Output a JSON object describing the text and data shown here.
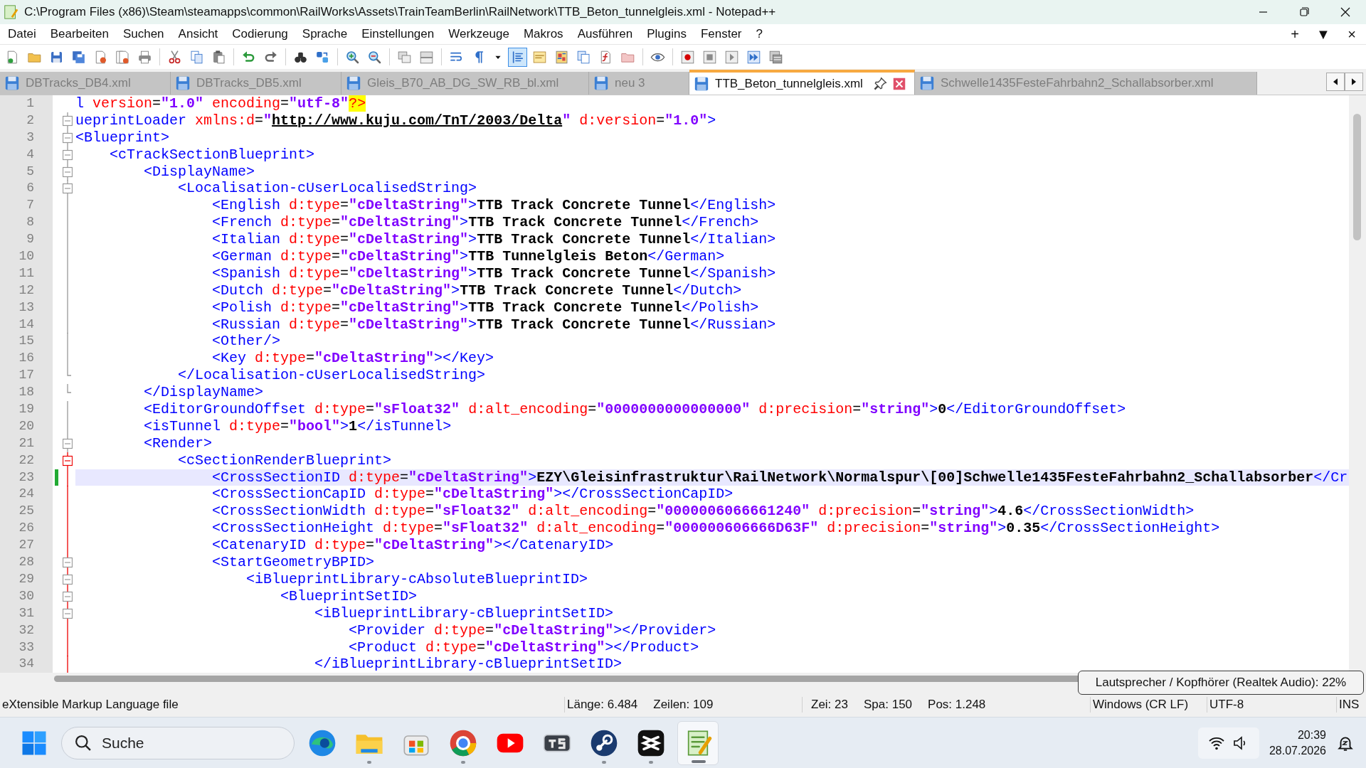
{
  "window": {
    "title": "C:\\Program Files (x86)\\Steam\\steamapps\\common\\RailWorks\\Assets\\TrainTeamBerlin\\RailNetwork\\TTB_Beton_tunnelgleis.xml - Notepad++"
  },
  "menu": [
    "Datei",
    "Bearbeiten",
    "Suchen",
    "Ansicht",
    "Codierung",
    "Sprache",
    "Einstellungen",
    "Werkzeuge",
    "Makros",
    "Ausführen",
    "Plugins",
    "Fenster",
    "?"
  ],
  "menu_right": [
    "+",
    "▼",
    "×"
  ],
  "toolbar": [
    [
      {
        "kind": "new",
        "on": false
      },
      {
        "kind": "open",
        "on": false
      },
      {
        "kind": "save",
        "on": false
      },
      {
        "kind": "saveall",
        "on": false
      },
      {
        "kind": "close",
        "on": false
      },
      {
        "kind": "closeall",
        "on": false
      },
      {
        "kind": "print",
        "on": false
      }
    ],
    [
      {
        "kind": "cut",
        "on": false
      },
      {
        "kind": "copy",
        "on": false
      },
      {
        "kind": "paste",
        "on": false
      }
    ],
    [
      {
        "kind": "undo",
        "on": false
      },
      {
        "kind": "redo",
        "on": false
      }
    ],
    [
      {
        "kind": "find",
        "on": false
      },
      {
        "kind": "replace",
        "on": false
      }
    ],
    [
      {
        "kind": "zoomin",
        "on": false
      },
      {
        "kind": "zoomout",
        "on": false
      }
    ],
    [
      {
        "kind": "syncv",
        "on": false
      },
      {
        "kind": "synch",
        "on": false
      }
    ],
    [
      {
        "kind": "wrap",
        "on": false
      },
      {
        "kind": "pilcrow",
        "on": false
      },
      {
        "kind": "caret",
        "on": false
      },
      {
        "kind": "indent",
        "on": true
      },
      {
        "kind": "udl",
        "on": false
      },
      {
        "kind": "map",
        "on": false
      },
      {
        "kind": "doclist",
        "on": false
      },
      {
        "kind": "func",
        "on": false
      },
      {
        "kind": "folder",
        "on": false
      }
    ],
    [
      {
        "kind": "eye",
        "on": false
      }
    ],
    [
      {
        "kind": "rec",
        "on": false
      },
      {
        "kind": "stop",
        "on": false
      },
      {
        "kind": "play",
        "on": false
      },
      {
        "kind": "playmulti",
        "on": false
      },
      {
        "kind": "macrosave",
        "on": false
      }
    ]
  ],
  "tabs": [
    {
      "label": "DBTracks_DB4.xml",
      "selected": false
    },
    {
      "label": "DBTracks_DB5.xml",
      "selected": false
    },
    {
      "label": "Gleis_B70_AB_DG_SW_RB_bl.xml",
      "selected": false
    },
    {
      "label": "neu 3",
      "selected": false
    },
    {
      "label": "TTB_Beton_tunnelgleis.xml",
      "selected": true
    },
    {
      "label": "Schwelle1435FesteFahrbahn2_Schallabsorber.xml",
      "selected": false
    }
  ],
  "lines": [
    {
      "number": "1",
      "fold": {
        "kind": "none"
      },
      "selected": false,
      "modified": false,
      "tokens": [
        {
          "kind": "tag",
          "text": "l"
        },
        {
          "kind": "attr",
          "text": " version"
        },
        {
          "kind": "eq",
          "text": "="
        },
        {
          "kind": "val",
          "text": "\"1.0\""
        },
        {
          "kind": "attr",
          "text": " encoding"
        },
        {
          "kind": "eq",
          "text": "="
        },
        {
          "kind": "val",
          "text": "\"utf-8\""
        },
        {
          "kind": "pi",
          "text": "?>"
        }
      ]
    },
    {
      "number": "2",
      "fold": {
        "kind": "box"
      },
      "selected": false,
      "modified": false,
      "tokens": [
        {
          "kind": "tag",
          "text": "ueprintLoader"
        },
        {
          "kind": "attr",
          "text": " xmlns:d"
        },
        {
          "kind": "eq",
          "text": "="
        },
        {
          "kind": "val",
          "text": "\""
        },
        {
          "kind": "link",
          "text": "http://www.kuju.com/TnT/2003/Delta"
        },
        {
          "kind": "val",
          "text": "\""
        },
        {
          "kind": "attr",
          "text": " d:version"
        },
        {
          "kind": "eq",
          "text": "="
        },
        {
          "kind": "val",
          "text": "\"1.0\""
        },
        {
          "kind": "tag",
          "text": ">"
        }
      ]
    },
    {
      "number": "3",
      "fold": {
        "kind": "box"
      },
      "selected": false,
      "modified": false,
      "tokens": [
        {
          "kind": "tag",
          "text": "<Blueprint>"
        }
      ]
    },
    {
      "number": "4",
      "fold": {
        "kind": "box"
      },
      "selected": false,
      "modified": false,
      "tokens": [
        {
          "kind": "tag",
          "text": "    <cTrackSectionBlueprint>"
        }
      ]
    },
    {
      "number": "5",
      "fold": {
        "kind": "box"
      },
      "selected": false,
      "modified": false,
      "tokens": [
        {
          "kind": "tag",
          "text": "        <DisplayName>"
        }
      ]
    },
    {
      "number": "6",
      "fold": {
        "kind": "box"
      },
      "selected": false,
      "modified": false,
      "tokens": [
        {
          "kind": "tag",
          "text": "            <Localisation-cUserLocalisedString>"
        }
      ]
    },
    {
      "number": "7",
      "fold": {
        "kind": "line"
      },
      "selected": false,
      "modified": false,
      "tokens": [
        {
          "kind": "tag",
          "text": "                <English"
        },
        {
          "kind": "attr",
          "text": " d:type"
        },
        {
          "kind": "eq",
          "text": "="
        },
        {
          "kind": "val",
          "text": "\"cDeltaString\""
        },
        {
          "kind": "tag",
          "text": ">"
        },
        {
          "kind": "text",
          "text": "TTB Track Concrete Tunnel"
        },
        {
          "kind": "tag",
          "text": "</English>"
        }
      ]
    },
    {
      "number": "8",
      "fold": {
        "kind": "line"
      },
      "selected": false,
      "modified": false,
      "tokens": [
        {
          "kind": "tag",
          "text": "                <French"
        },
        {
          "kind": "attr",
          "text": " d:type"
        },
        {
          "kind": "eq",
          "text": "="
        },
        {
          "kind": "val",
          "text": "\"cDeltaString\""
        },
        {
          "kind": "tag",
          "text": ">"
        },
        {
          "kind": "text",
          "text": "TTB Track Concrete Tunnel"
        },
        {
          "kind": "tag",
          "text": "</French>"
        }
      ]
    },
    {
      "number": "9",
      "fold": {
        "kind": "line"
      },
      "selected": false,
      "modified": false,
      "tokens": [
        {
          "kind": "tag",
          "text": "                <Italian"
        },
        {
          "kind": "attr",
          "text": " d:type"
        },
        {
          "kind": "eq",
          "text": "="
        },
        {
          "kind": "val",
          "text": "\"cDeltaString\""
        },
        {
          "kind": "tag",
          "text": ">"
        },
        {
          "kind": "text",
          "text": "TTB Track Concrete Tunnel"
        },
        {
          "kind": "tag",
          "text": "</Italian>"
        }
      ]
    },
    {
      "number": "10",
      "fold": {
        "kind": "line"
      },
      "selected": false,
      "modified": false,
      "tokens": [
        {
          "kind": "tag",
          "text": "                <German"
        },
        {
          "kind": "attr",
          "text": " d:type"
        },
        {
          "kind": "eq",
          "text": "="
        },
        {
          "kind": "val",
          "text": "\"cDeltaString\""
        },
        {
          "kind": "tag",
          "text": ">"
        },
        {
          "kind": "text",
          "text": "TTB Tunnelgleis Beton"
        },
        {
          "kind": "tag",
          "text": "</German>"
        }
      ]
    },
    {
      "number": "11",
      "fold": {
        "kind": "line"
      },
      "selected": false,
      "modified": false,
      "tokens": [
        {
          "kind": "tag",
          "text": "                <Spanish"
        },
        {
          "kind": "attr",
          "text": " d:type"
        },
        {
          "kind": "eq",
          "text": "="
        },
        {
          "kind": "val",
          "text": "\"cDeltaString\""
        },
        {
          "kind": "tag",
          "text": ">"
        },
        {
          "kind": "text",
          "text": "TTB Track Concrete Tunnel"
        },
        {
          "kind": "tag",
          "text": "</Spanish>"
        }
      ]
    },
    {
      "number": "12",
      "fold": {
        "kind": "line"
      },
      "selected": false,
      "modified": false,
      "tokens": [
        {
          "kind": "tag",
          "text": "                <Dutch"
        },
        {
          "kind": "attr",
          "text": " d:type"
        },
        {
          "kind": "eq",
          "text": "="
        },
        {
          "kind": "val",
          "text": "\"cDeltaString\""
        },
        {
          "kind": "tag",
          "text": ">"
        },
        {
          "kind": "text",
          "text": "TTB Track Concrete Tunnel"
        },
        {
          "kind": "tag",
          "text": "</Dutch>"
        }
      ]
    },
    {
      "number": "13",
      "fold": {
        "kind": "line"
      },
      "selected": false,
      "modified": false,
      "tokens": [
        {
          "kind": "tag",
          "text": "                <Polish"
        },
        {
          "kind": "attr",
          "text": " d:type"
        },
        {
          "kind": "eq",
          "text": "="
        },
        {
          "kind": "val",
          "text": "\"cDeltaString\""
        },
        {
          "kind": "tag",
          "text": ">"
        },
        {
          "kind": "text",
          "text": "TTB Track Concrete Tunnel"
        },
        {
          "kind": "tag",
          "text": "</Polish>"
        }
      ]
    },
    {
      "number": "14",
      "fold": {
        "kind": "line"
      },
      "selected": false,
      "modified": false,
      "tokens": [
        {
          "kind": "tag",
          "text": "                <Russian"
        },
        {
          "kind": "attr",
          "text": " d:type"
        },
        {
          "kind": "eq",
          "text": "="
        },
        {
          "kind": "val",
          "text": "\"cDeltaString\""
        },
        {
          "kind": "tag",
          "text": ">"
        },
        {
          "kind": "text",
          "text": "TTB Track Concrete Tunnel"
        },
        {
          "kind": "tag",
          "text": "</Russian>"
        }
      ]
    },
    {
      "number": "15",
      "fold": {
        "kind": "line"
      },
      "selected": false,
      "modified": false,
      "tokens": [
        {
          "kind": "tag",
          "text": "                <Other/>"
        }
      ]
    },
    {
      "number": "16",
      "fold": {
        "kind": "line"
      },
      "selected": false,
      "modified": false,
      "tokens": [
        {
          "kind": "tag",
          "text": "                <Key"
        },
        {
          "kind": "attr",
          "text": " d:type"
        },
        {
          "kind": "eq",
          "text": "="
        },
        {
          "kind": "val",
          "text": "\"cDeltaString\""
        },
        {
          "kind": "tag",
          "text": "></Key>"
        }
      ]
    },
    {
      "number": "17",
      "fold": {
        "kind": "end"
      },
      "selected": false,
      "modified": false,
      "tokens": [
        {
          "kind": "tag",
          "text": "            </Localisation-cUserLocalisedString>"
        }
      ]
    },
    {
      "number": "18",
      "fold": {
        "kind": "end"
      },
      "selected": false,
      "modified": false,
      "tokens": [
        {
          "kind": "tag",
          "text": "        </DisplayName>"
        }
      ]
    },
    {
      "number": "19",
      "fold": {
        "kind": "line"
      },
      "selected": false,
      "modified": false,
      "tokens": [
        {
          "kind": "tag",
          "text": "        <EditorGroundOffset"
        },
        {
          "kind": "attr",
          "text": " d:type"
        },
        {
          "kind": "eq",
          "text": "="
        },
        {
          "kind": "val",
          "text": "\"sFloat32\""
        },
        {
          "kind": "attr",
          "text": " d:alt_encoding"
        },
        {
          "kind": "eq",
          "text": "="
        },
        {
          "kind": "val",
          "text": "\"0000000000000000\""
        },
        {
          "kind": "attr",
          "text": " d:precision"
        },
        {
          "kind": "eq",
          "text": "="
        },
        {
          "kind": "val",
          "text": "\"string\""
        },
        {
          "kind": "tag",
          "text": ">"
        },
        {
          "kind": "text",
          "text": "0"
        },
        {
          "kind": "tag",
          "text": "</EditorGroundOffset>"
        }
      ]
    },
    {
      "number": "20",
      "fold": {
        "kind": "line"
      },
      "selected": false,
      "modified": false,
      "tokens": [
        {
          "kind": "tag",
          "text": "        <isTunnel"
        },
        {
          "kind": "attr",
          "text": " d:type"
        },
        {
          "kind": "eq",
          "text": "="
        },
        {
          "kind": "val",
          "text": "\"bool\""
        },
        {
          "kind": "tag",
          "text": ">"
        },
        {
          "kind": "text",
          "text": "1"
        },
        {
          "kind": "tag",
          "text": "</isTunnel>"
        }
      ]
    },
    {
      "number": "21",
      "fold": {
        "kind": "box"
      },
      "selected": false,
      "modified": false,
      "tokens": [
        {
          "kind": "tag",
          "text": "        <Render>"
        }
      ]
    },
    {
      "number": "22",
      "fold": {
        "kind": "red-box"
      },
      "selected": false,
      "modified": false,
      "tokens": [
        {
          "kind": "tag",
          "text": "            <cSectionRenderBlueprint>"
        }
      ]
    },
    {
      "number": "23",
      "fold": {
        "kind": "red-line"
      },
      "selected": true,
      "modified": true,
      "tokens": [
        {
          "kind": "tag",
          "text": "                <CrossSectionID"
        },
        {
          "kind": "attr",
          "text": " d:type"
        },
        {
          "kind": "eq",
          "text": "="
        },
        {
          "kind": "val",
          "text": "\"cDeltaString\""
        },
        {
          "kind": "tag",
          "text": ">"
        },
        {
          "kind": "text",
          "text": "EZY\\Gleisinfrastruktur\\RailNetwork\\Normalspur\\[00]Schwelle1435FesteFahrbahn2_Schallabsorber"
        },
        {
          "kind": "tag",
          "text": "</Cr"
        }
      ]
    },
    {
      "number": "24",
      "fold": {
        "kind": "red-line"
      },
      "selected": false,
      "modified": false,
      "tokens": [
        {
          "kind": "tag",
          "text": "                <CrossSectionCapID"
        },
        {
          "kind": "attr",
          "text": " d:type"
        },
        {
          "kind": "eq",
          "text": "="
        },
        {
          "kind": "val",
          "text": "\"cDeltaString\""
        },
        {
          "kind": "tag",
          "text": "></CrossSectionCapID>"
        }
      ]
    },
    {
      "number": "25",
      "fold": {
        "kind": "red-line"
      },
      "selected": false,
      "modified": false,
      "tokens": [
        {
          "kind": "tag",
          "text": "                <CrossSectionWidth"
        },
        {
          "kind": "attr",
          "text": " d:type"
        },
        {
          "kind": "eq",
          "text": "="
        },
        {
          "kind": "val",
          "text": "\"sFloat32\""
        },
        {
          "kind": "attr",
          "text": " d:alt_encoding"
        },
        {
          "kind": "eq",
          "text": "="
        },
        {
          "kind": "val",
          "text": "\"0000006066661240\""
        },
        {
          "kind": "attr",
          "text": " d:precision"
        },
        {
          "kind": "eq",
          "text": "="
        },
        {
          "kind": "val",
          "text": "\"string\""
        },
        {
          "kind": "tag",
          "text": ">"
        },
        {
          "kind": "text",
          "text": "4.6"
        },
        {
          "kind": "tag",
          "text": "</CrossSectionWidth>"
        }
      ]
    },
    {
      "number": "26",
      "fold": {
        "kind": "red-line"
      },
      "selected": false,
      "modified": false,
      "tokens": [
        {
          "kind": "tag",
          "text": "                <CrossSectionHeight"
        },
        {
          "kind": "attr",
          "text": " d:type"
        },
        {
          "kind": "eq",
          "text": "="
        },
        {
          "kind": "val",
          "text": "\"sFloat32\""
        },
        {
          "kind": "attr",
          "text": " d:alt_encoding"
        },
        {
          "kind": "eq",
          "text": "="
        },
        {
          "kind": "val",
          "text": "\"000000606666D63F\""
        },
        {
          "kind": "attr",
          "text": " d:precision"
        },
        {
          "kind": "eq",
          "text": "="
        },
        {
          "kind": "val",
          "text": "\"string\""
        },
        {
          "kind": "tag",
          "text": ">"
        },
        {
          "kind": "text",
          "text": "0.35"
        },
        {
          "kind": "tag",
          "text": "</CrossSectionHeight>"
        }
      ]
    },
    {
      "number": "27",
      "fold": {
        "kind": "red-line"
      },
      "selected": false,
      "modified": false,
      "tokens": [
        {
          "kind": "tag",
          "text": "                <CatenaryID"
        },
        {
          "kind": "attr",
          "text": " d:type"
        },
        {
          "kind": "eq",
          "text": "="
        },
        {
          "kind": "val",
          "text": "\"cDeltaString\""
        },
        {
          "kind": "tag",
          "text": "></CatenaryID>"
        }
      ]
    },
    {
      "number": "28",
      "fold": {
        "kind": "box-on-red"
      },
      "selected": false,
      "modified": false,
      "tokens": [
        {
          "kind": "tag",
          "text": "                <StartGeometryBPID>"
        }
      ]
    },
    {
      "number": "29",
      "fold": {
        "kind": "box-on-red"
      },
      "selected": false,
      "modified": false,
      "tokens": [
        {
          "kind": "tag",
          "text": "                    <iBlueprintLibrary-cAbsoluteBlueprintID>"
        }
      ]
    },
    {
      "number": "30",
      "fold": {
        "kind": "box-on-red"
      },
      "selected": false,
      "modified": false,
      "tokens": [
        {
          "kind": "tag",
          "text": "                        <BlueprintSetID>"
        }
      ]
    },
    {
      "number": "31",
      "fold": {
        "kind": "box-on-red"
      },
      "selected": false,
      "modified": false,
      "tokens": [
        {
          "kind": "tag",
          "text": "                            <iBlueprintLibrary-cBlueprintSetID>"
        }
      ]
    },
    {
      "number": "32",
      "fold": {
        "kind": "red-line"
      },
      "selected": false,
      "modified": false,
      "tokens": [
        {
          "kind": "tag",
          "text": "                                <Provider"
        },
        {
          "kind": "attr",
          "text": " d:type"
        },
        {
          "kind": "eq",
          "text": "="
        },
        {
          "kind": "val",
          "text": "\"cDeltaString\""
        },
        {
          "kind": "tag",
          "text": "></Provider>"
        }
      ]
    },
    {
      "number": "33",
      "fold": {
        "kind": "red-line"
      },
      "selected": false,
      "modified": false,
      "tokens": [
        {
          "kind": "tag",
          "text": "                                <Product"
        },
        {
          "kind": "attr",
          "text": " d:type"
        },
        {
          "kind": "eq",
          "text": "="
        },
        {
          "kind": "val",
          "text": "\"cDeltaString\""
        },
        {
          "kind": "tag",
          "text": "></Product>"
        }
      ]
    },
    {
      "number": "34",
      "fold": {
        "kind": "red-line"
      },
      "selected": false,
      "modified": false,
      "tokens": [
        {
          "kind": "tag",
          "text": "                            </iBlueprintLibrary-cBlueprintSetID>"
        }
      ]
    }
  ],
  "status_bar": {
    "file_type": "eXtensible Markup Language file",
    "length": "Länge: 6.484",
    "lines": "Zeilen: 109",
    "line": "Zei: 23",
    "column": "Spa: 150",
    "position": "Pos: 1.248",
    "eol": "Windows (CR LF)",
    "encoding": "UTF-8",
    "mode": "INS"
  },
  "tooltip": "Lautsprecher / Kopfhörer (Realtek Audio): 22%",
  "taskbar": {
    "search": {
      "placeholder": "Suche"
    },
    "apps": [
      {
        "kind": "edge",
        "running": false,
        "selected": false
      },
      {
        "kind": "explorer",
        "running": true,
        "selected": false
      },
      {
        "kind": "store",
        "running": false,
        "selected": false
      },
      {
        "kind": "chrome",
        "running": true,
        "selected": false
      },
      {
        "kind": "youtube",
        "running": false,
        "selected": false
      },
      {
        "kind": "ts",
        "running": false,
        "selected": false
      },
      {
        "kind": "steam",
        "running": true,
        "selected": false
      },
      {
        "kind": "capcut",
        "running": true,
        "selected": false
      },
      {
        "kind": "notepad",
        "running": true,
        "selected": true
      }
    ],
    "time": "20:39",
    "date": "28.07.2026"
  }
}
